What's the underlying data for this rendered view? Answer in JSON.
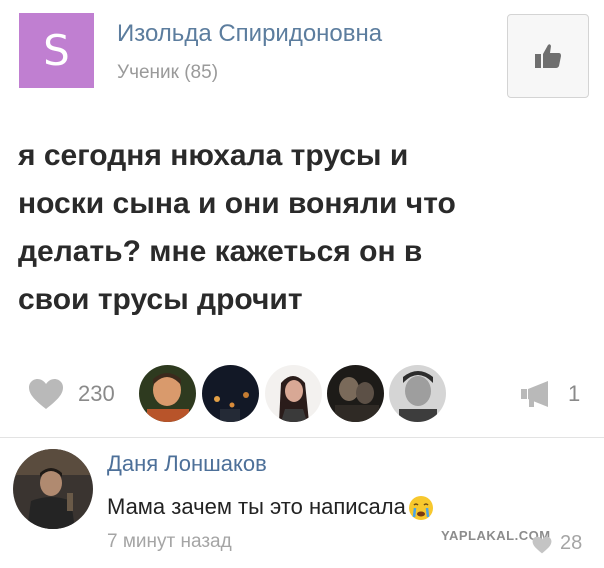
{
  "post": {
    "avatar_letter": "S",
    "avatar_color": "#c07fd1",
    "author_name": "Изольда Спиридоновна",
    "author_rank": "Ученик (85)",
    "text": "я сегодня нюхала трусы и\nноски сына и они воняли что\nделать? мне кажеться он в\nсвои трусы дрочит"
  },
  "stats": {
    "like_icon": "heart-icon",
    "like_count": "230",
    "likers": [
      {
        "name": "liker-avatar-1"
      },
      {
        "name": "liker-avatar-2"
      },
      {
        "name": "liker-avatar-3"
      },
      {
        "name": "liker-avatar-4"
      },
      {
        "name": "liker-avatar-5"
      }
    ],
    "repost_icon": "megaphone-icon",
    "repost_count": "1"
  },
  "comment": {
    "author_name": "Даня Лоншаков",
    "text": "Мама зачем ты это написала",
    "emoji": "crying-face-emoji",
    "time": "7 минут назад",
    "likes": "28"
  },
  "watermark": "YAPLAKAL.COM",
  "colors": {
    "link_blue": "#5c7d9e",
    "muted_gray": "#9a9a9a"
  }
}
